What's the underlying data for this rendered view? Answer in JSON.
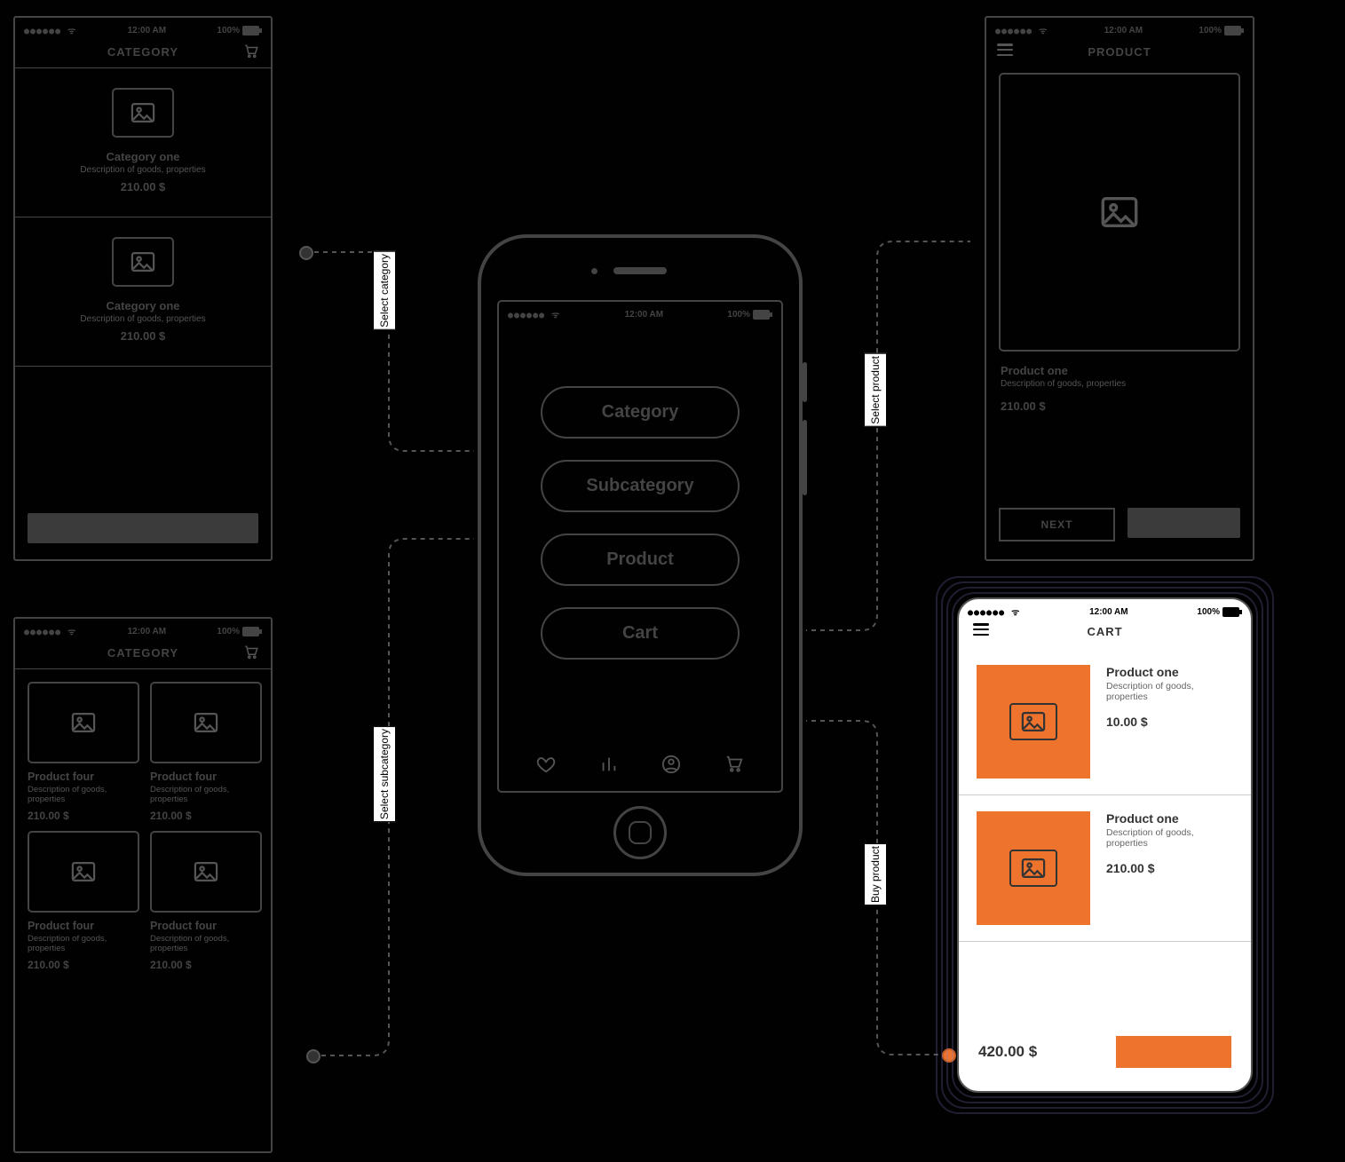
{
  "status": {
    "signal": "●●●●●●  ᯤ",
    "time": "12:00 AM",
    "battery": "100%"
  },
  "nav_labels": {
    "select_category": "Select category",
    "select_subcategory": "Select subcategory",
    "select_product": "Select product",
    "buy_product": "Buy product"
  },
  "center": {
    "buttons": [
      "Category",
      "Subcategory",
      "Product",
      "Cart"
    ]
  },
  "category_screen": {
    "header": "CATEGORY",
    "items": [
      {
        "title": "Category one",
        "desc": "Description of goods, properties",
        "price": "210.00 $"
      },
      {
        "title": "Category one",
        "desc": "Description of goods, properties",
        "price": "210.00 $"
      }
    ]
  },
  "subcategory_screen": {
    "header": "CATEGORY",
    "items": [
      {
        "title": "Product four",
        "desc": "Description of goods, properties",
        "price": "210.00 $"
      },
      {
        "title": "Product four",
        "desc": "Description of goods, properties",
        "price": "210.00 $"
      },
      {
        "title": "Product four",
        "desc": "Description of goods, properties",
        "price": "210.00 $"
      },
      {
        "title": "Product four",
        "desc": "Description of goods, properties",
        "price": "210.00 $"
      }
    ]
  },
  "product_screen": {
    "header": "PRODUCT",
    "title": "Product one",
    "desc": "Description of goods, properties",
    "price": "210.00 $",
    "next_label": "NEXT"
  },
  "cart_screen": {
    "header": "CART",
    "items": [
      {
        "title": "Product one",
        "desc": "Description of goods, properties",
        "price": "10.00 $"
      },
      {
        "title": "Product one",
        "desc": "Description of goods, properties",
        "price": "210.00 $"
      }
    ],
    "total": "420.00 $"
  },
  "colors": {
    "accent": "#ee742d"
  }
}
